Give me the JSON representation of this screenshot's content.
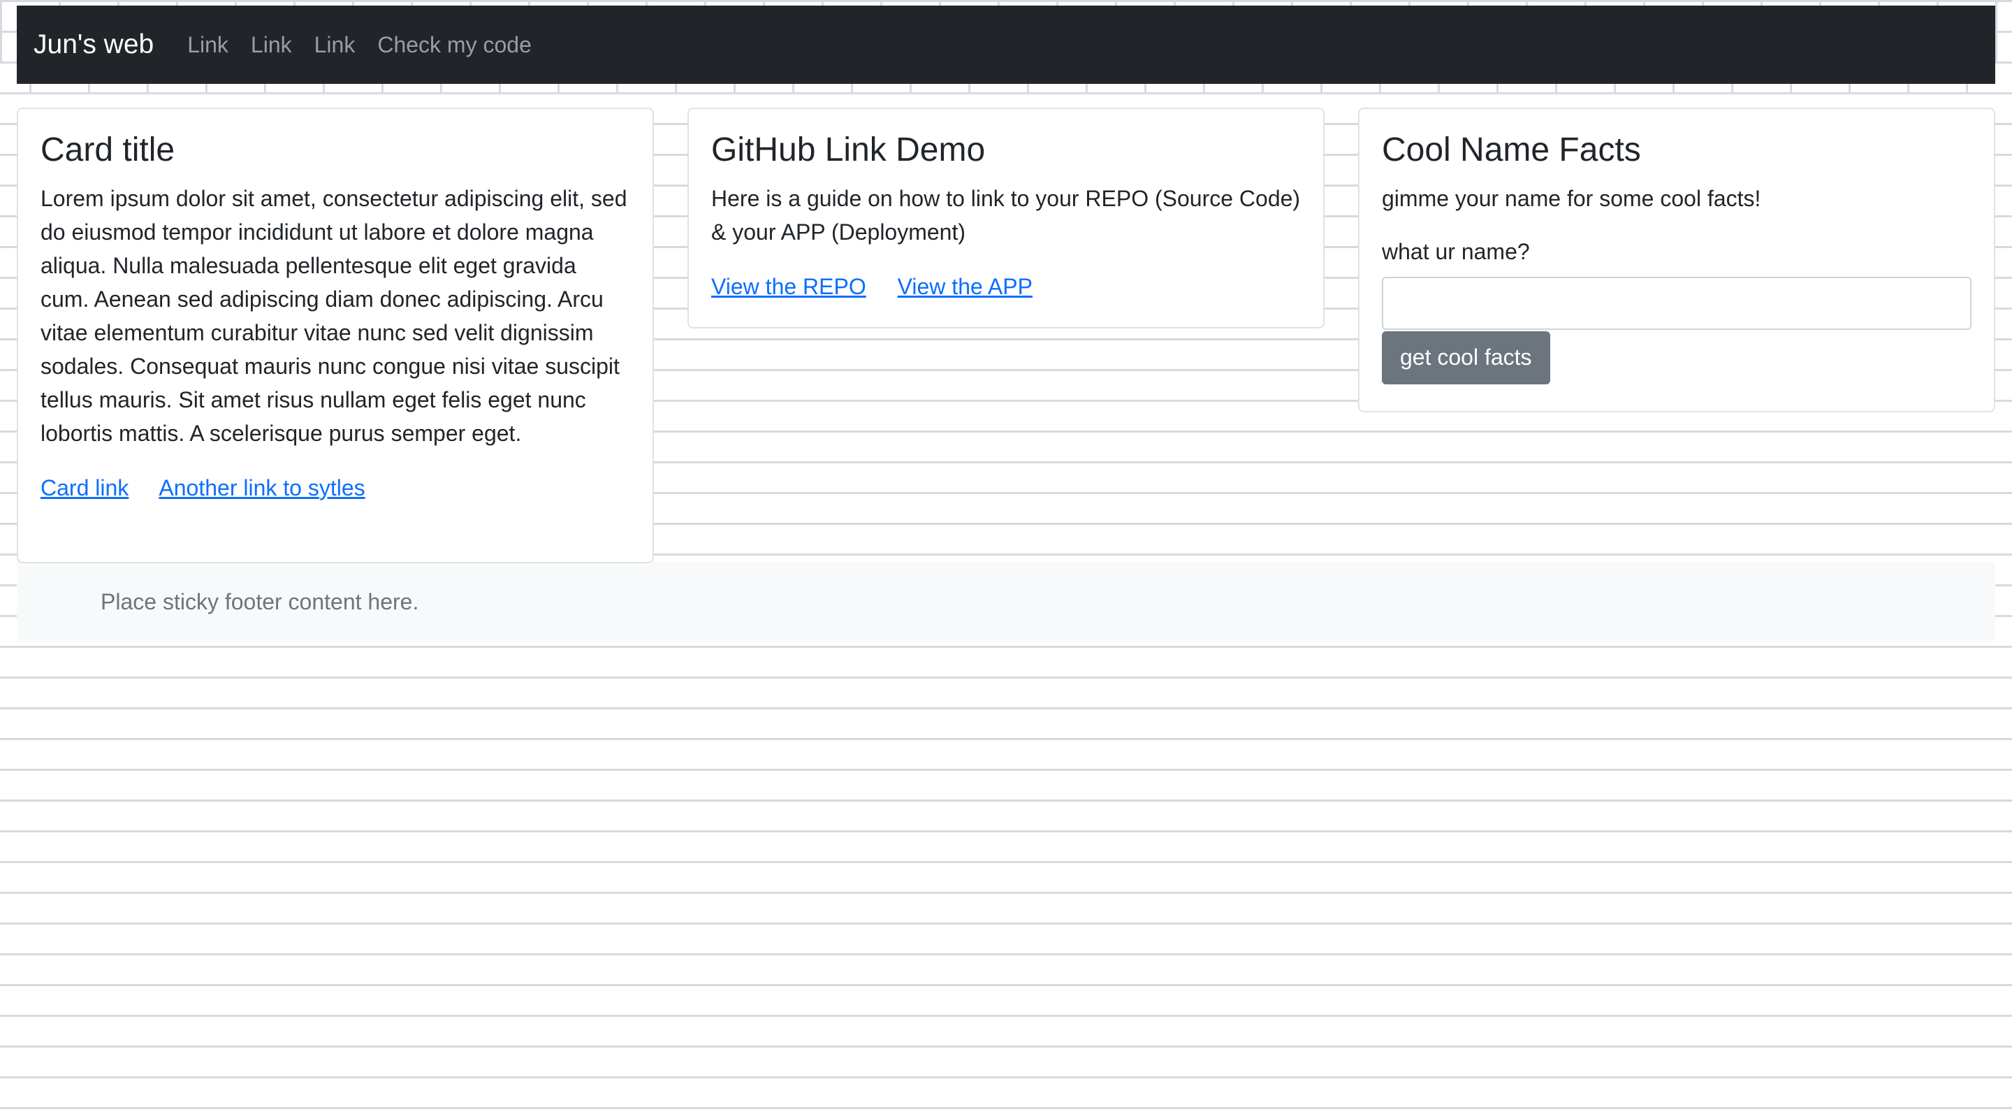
{
  "navbar": {
    "brand": "Jun's web",
    "links": [
      "Link",
      "Link",
      "Link",
      "Check my code"
    ]
  },
  "card1": {
    "title": "Card title",
    "text": "Lorem ipsum dolor sit amet, consectetur adipiscing elit, sed do eiusmod tempor incididunt ut labore et dolore magna aliqua. Nulla malesuada pellentesque elit eget gravida cum. Aenean sed adipiscing diam donec adipiscing. Arcu vitae elementum curabitur vitae nunc sed velit dignissim sodales. Consequat mauris nunc congue nisi vitae suscipit tellus mauris. Sit amet risus nullam eget felis eget nunc lobortis mattis. A scelerisque purus semper eget.",
    "link1": "Card link",
    "link2": "Another link to sytles"
  },
  "card2": {
    "title": "GitHub Link Demo",
    "text": "Here is a guide on how to link to your REPO (Source Code) & your APP (Deployment)",
    "link1": "View the REPO",
    "link2": "View the APP"
  },
  "card3": {
    "title": "Cool Name Facts",
    "text": "gimme your name for some cool facts!",
    "input_label": "what ur name?",
    "input_value": "",
    "button": "get cool facts"
  },
  "footer": {
    "text": "Place sticky footer content here."
  },
  "colors": {
    "navbar_bg": "#212529",
    "link": "#0d6efd",
    "button_bg": "#6c757d",
    "footer_bg": "#f8f9fa"
  }
}
